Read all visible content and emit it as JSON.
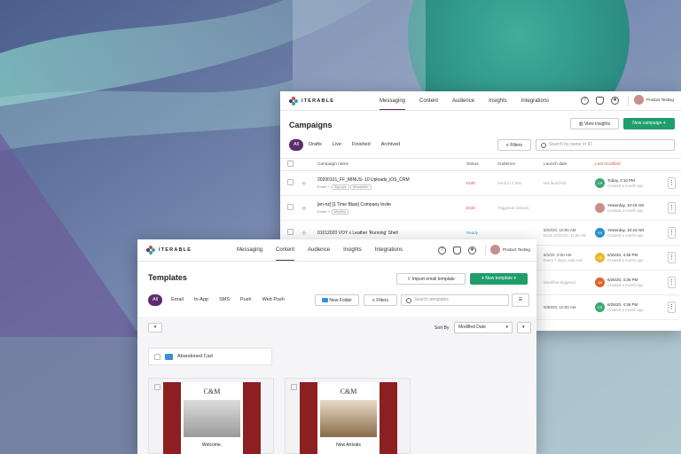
{
  "campaigns_window": {
    "brand": "ITERABLE",
    "nav": [
      "Messaging",
      "Content",
      "Audience",
      "Insights",
      "Integrations"
    ],
    "user": "Product Testing",
    "title": "Campaigns",
    "view_insights": "View insights",
    "new_campaign": "New campaign",
    "tabs": [
      "All",
      "Drafts",
      "Live",
      "Finished",
      "Archived"
    ],
    "filters": "Filters",
    "search_placeholder": "Search by name or ID",
    "columns": [
      "Campaign name",
      "Status",
      "Audience",
      "Launch date",
      "Last modified"
    ],
    "rows": [
      {
        "name": "20200101_FF_MINUS- 10 Uploads_iOS_CRM",
        "channel": "Email",
        "tags": [
          "Signups",
          "Newsletter"
        ],
        "status": "Draft",
        "audience": "Send to 2 lists",
        "launch": "Not launched",
        "modified": "Today, 3:10 PM",
        "modified_sub": "Created a month ago",
        "initials": "CR",
        "color": "#3aa877"
      },
      {
        "name": "[en-nz] [1 Time Blast] Company Invite",
        "channel": "Email",
        "tags": [
          "Monthly"
        ],
        "status": "Draft",
        "audience": "Triggered contacts",
        "launch": "",
        "modified": "Yesterday, 10:43 AM",
        "modified_sub": "Created a month ago",
        "initials": "",
        "color": "#c98d8d"
      },
      {
        "name": "01012020 VOY x Leather 'Running' Shell",
        "channel": "",
        "tags": [],
        "status": "Ready",
        "audience": "",
        "launch": "8/20/20, 10:00 AM",
        "launch_sub": "Ends 10/31/20, 11:00 AM",
        "modified": "Yesterday, 10:43 AM",
        "modified_sub": "Created a month ago",
        "initials": "SS",
        "color": "#2d8fc4"
      },
      {
        "name": "",
        "channel": "",
        "tags": [],
        "status": "",
        "audience": "",
        "launch": "9/1/20, 8:00 AM",
        "launch_sub": "Every 7 days, until end",
        "modified": "6/26/20, 4:36 PM",
        "modified_sub": "Created a month ago",
        "initials": "CE",
        "color": "#e8b82a"
      },
      {
        "name": "",
        "channel": "",
        "tags": [],
        "status": "",
        "audience": "",
        "launch": "Workflow triggered",
        "modified": "6/26/20, 4:36 PM",
        "modified_sub": "Created a month ago",
        "initials": "JW",
        "color": "#e0622d"
      },
      {
        "name": "",
        "channel": "",
        "tags": [],
        "status": "",
        "audience": "",
        "launch": "9/30/20, 10:00 AM",
        "modified": "6/26/20, 4:36 PM",
        "modified_sub": "Created a month ago",
        "initials": "CR",
        "color": "#3aa877"
      }
    ]
  },
  "templates_window": {
    "brand": "ITERABLE",
    "nav": [
      "Messaging",
      "Content",
      "Audience",
      "Insights",
      "Integrations"
    ],
    "user": "Product Testing",
    "title": "Templates",
    "import_email": "Import email template",
    "new_template": "New template",
    "tabs": [
      "All",
      "Email",
      "In-App",
      "SMS",
      "Push",
      "Web Push"
    ],
    "new_folder": "New Folder",
    "filters": "Filters",
    "search_placeholder": "Search templates",
    "sort_by": "Sort By",
    "sort_value": "Modified Date",
    "folder": "Abandoned Cart",
    "cards": [
      {
        "brand": "C&M",
        "caption": "Welcome."
      },
      {
        "brand": "C&M",
        "caption": "New Arrivals"
      }
    ]
  },
  "colors": {
    "accent": "#5c2d6e",
    "primary": "#1f9e6c",
    "card_red": "#8c1f1f"
  }
}
